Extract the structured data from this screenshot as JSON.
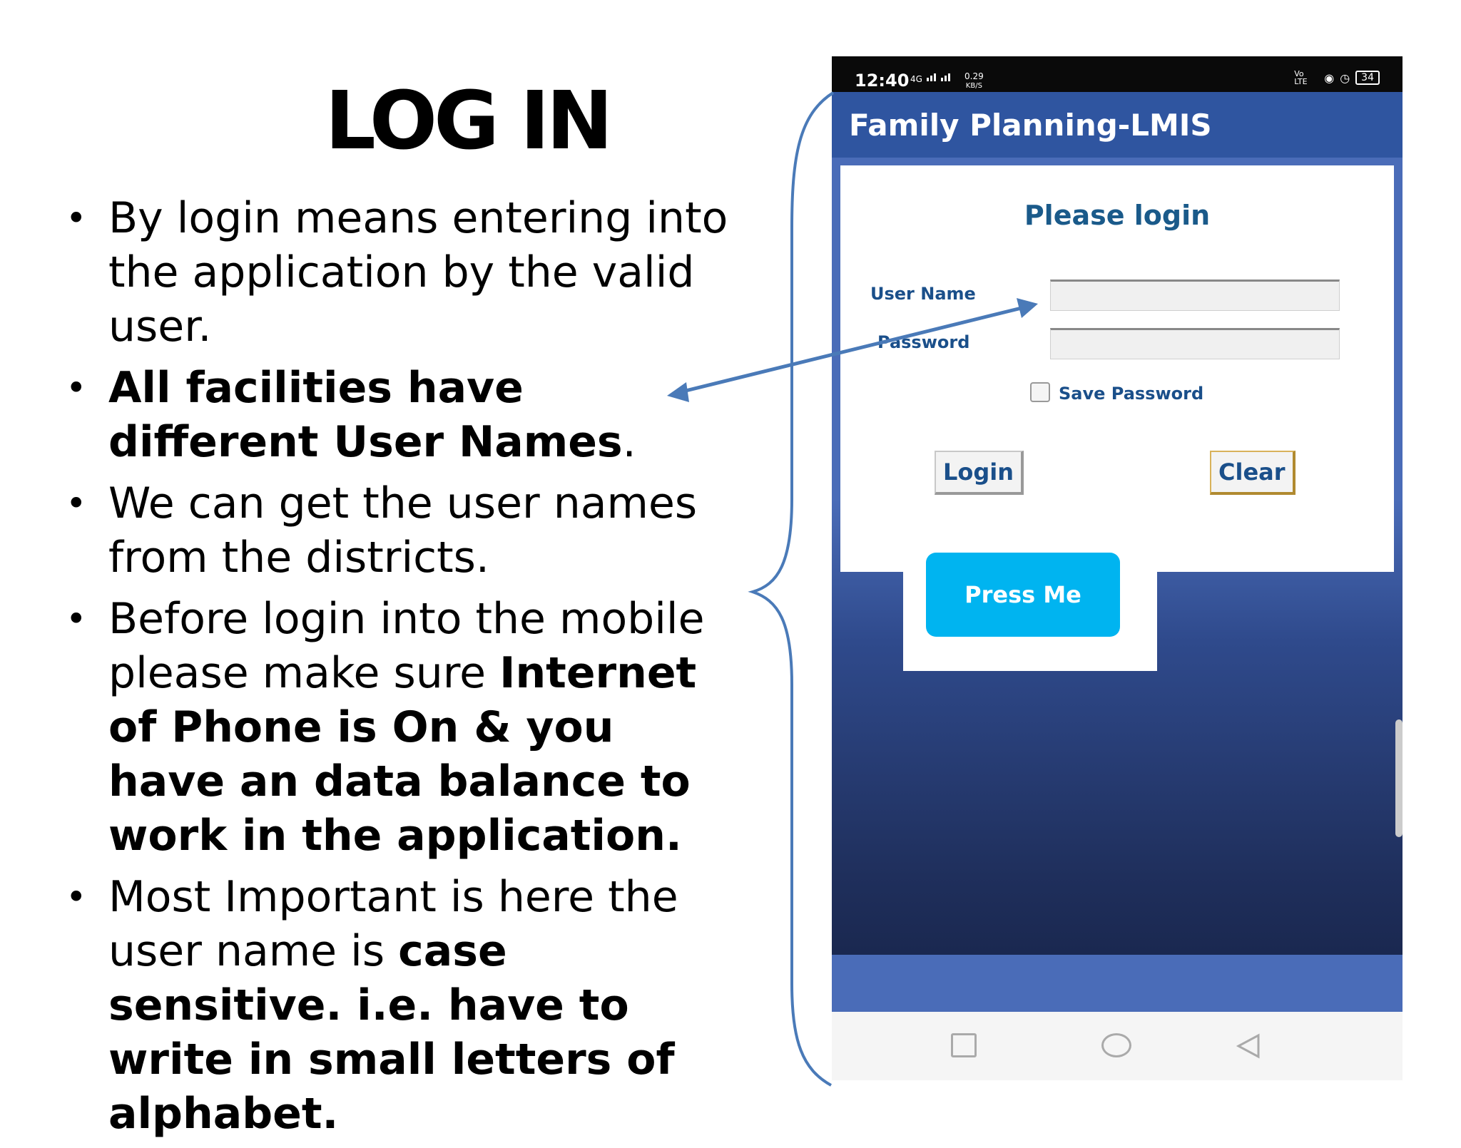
{
  "slide": {
    "title": "LOG IN",
    "bullets": [
      {
        "segments": [
          {
            "text": "By login means entering into the application by the valid user.",
            "bold": false
          }
        ]
      },
      {
        "segments": [
          {
            "text": "All facilities have different User Names",
            "bold": true
          },
          {
            "text": ".",
            "bold": false
          }
        ]
      },
      {
        "segments": [
          {
            "text": "We can get the user names from the districts.",
            "bold": false
          }
        ]
      },
      {
        "segments": [
          {
            "text": "Before login into the mobile please make sure ",
            "bold": false
          },
          {
            "text": "Internet of Phone is On & you have an data balance to work in the application.",
            "bold": true
          }
        ]
      },
      {
        "segments": [
          {
            "text": "Most Important is here the user name is ",
            "bold": false
          },
          {
            "text": "case sensitive. i.e. have to write in small letters of alphabet.",
            "bold": true
          }
        ]
      }
    ]
  },
  "phone": {
    "status_bar": {
      "time": "12:40",
      "network": "4G",
      "speed_value": "0.29",
      "speed_unit": "KB/S",
      "volte": "Vo LTE",
      "battery": "34"
    },
    "app_bar": {
      "title": "Family Planning-LMIS"
    },
    "login": {
      "heading": "Please login",
      "username_label": "User Name",
      "password_label": "Password",
      "username_value": "",
      "password_value": "",
      "save_password_label": "Save Password",
      "save_password_checked": false,
      "login_button": "Login",
      "clear_button": "Clear"
    },
    "press_me_button": "Press Me",
    "nav_icons": [
      "square-recent-icon",
      "circle-home-icon",
      "triangle-back-icon"
    ]
  },
  "colors": {
    "app_bar": "#2f55a0",
    "label_text": "#1a4f8a",
    "press_button": "#00b4f0",
    "annotation": "#4a7ab8"
  }
}
